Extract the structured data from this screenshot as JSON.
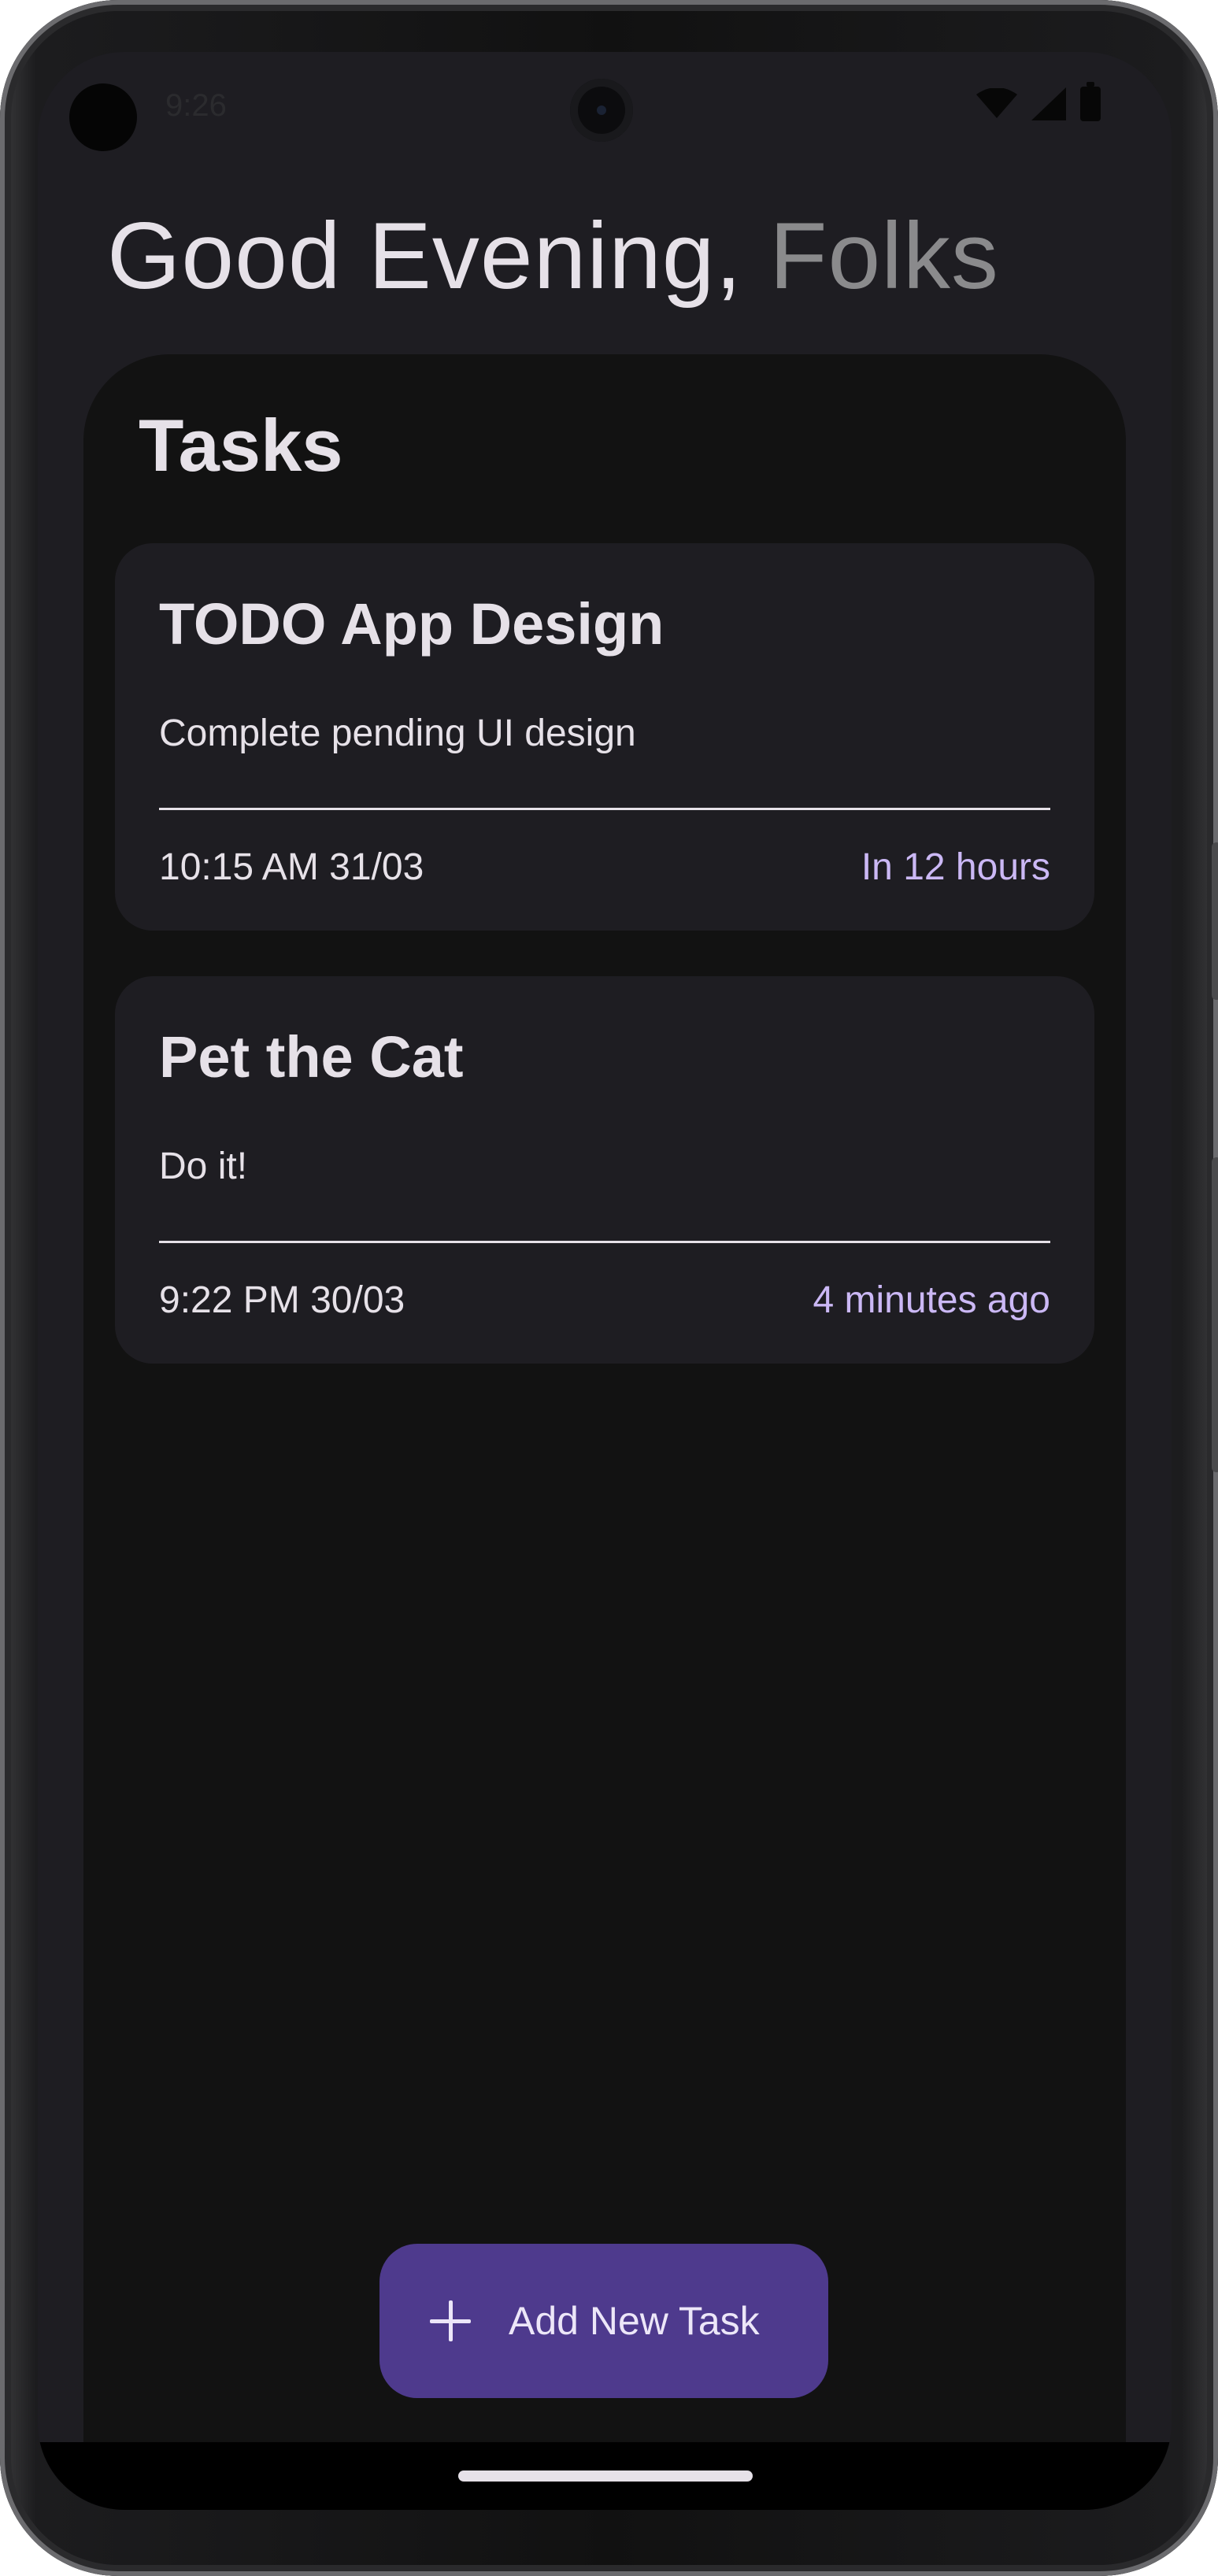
{
  "status_bar": {
    "time": "9:26",
    "icons": [
      "wifi-icon",
      "signal-icon",
      "battery-icon"
    ]
  },
  "greeting": {
    "salutation": "Good Evening,",
    "name": "Folks"
  },
  "tasks_section": {
    "title": "Tasks",
    "items": [
      {
        "title": "TODO App Design",
        "description": "Complete pending UI design",
        "datetime": "10:15 AM 31/03",
        "relative_time": "In 12 hours"
      },
      {
        "title": "Pet the Cat",
        "description": "Do it!",
        "datetime": "9:22 PM 30/03",
        "relative_time": "4 minutes ago"
      }
    ]
  },
  "fab": {
    "label": "Add New Task",
    "icon": "plus-icon"
  },
  "colors": {
    "background": "#1e1d22",
    "panel": "#121212",
    "card": "#1e1d22",
    "accent_text": "#cbb8f5",
    "fab": "#4e3a8d"
  }
}
